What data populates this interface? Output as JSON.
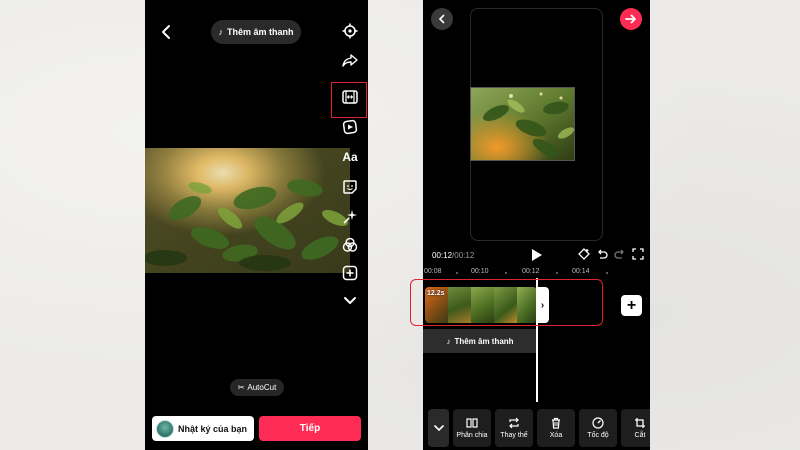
{
  "left_screen": {
    "header": {
      "add_sound_label": "Thêm âm thanh"
    },
    "tools": [
      {
        "icon": "settings-icon"
      },
      {
        "icon": "share-arrow-icon"
      },
      {
        "icon": "video-frame-icon",
        "highlighted": true
      },
      {
        "icon": "effects-icon"
      },
      {
        "icon": "text-icon",
        "label": "Aa"
      },
      {
        "icon": "sticker-icon"
      },
      {
        "icon": "sparkle-icon"
      },
      {
        "icon": "filters-icon"
      },
      {
        "icon": "add-icon"
      },
      {
        "icon": "chevron-down-icon"
      }
    ],
    "autocut_label": "AutoCut",
    "diary_button_label": "Nhật ký của bạn",
    "next_button_label": "Tiếp"
  },
  "right_screen": {
    "time": {
      "current": "00:12",
      "separator": "/",
      "total": "00:12"
    },
    "ruler_ticks": [
      "00:08",
      "00:10",
      "00:12",
      "00:14"
    ],
    "clip": {
      "duration": "12.2s"
    },
    "sound_track_label": "Thêm âm thanh",
    "toolbar": [
      {
        "icon": "split-icon",
        "label": "Phân chia"
      },
      {
        "icon": "replace-icon",
        "label": "Thay thế"
      },
      {
        "icon": "delete-icon",
        "label": "Xóa"
      },
      {
        "icon": "speed-icon",
        "label": "Tốc độ"
      },
      {
        "icon": "crop-icon",
        "label": "Cắt"
      }
    ]
  },
  "colors": {
    "accent": "#fe2c55",
    "highlight": "#e0242f"
  }
}
